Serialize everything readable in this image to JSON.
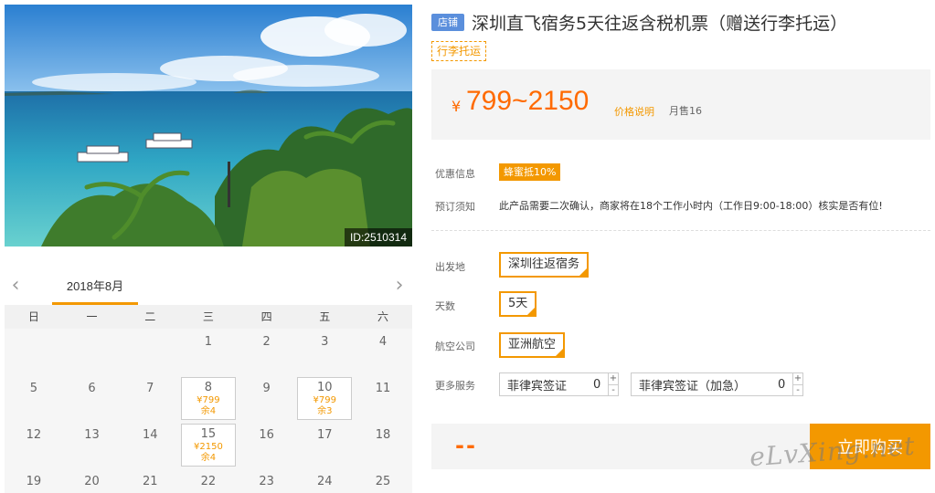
{
  "photo": {
    "id_label": "ID:2510314"
  },
  "calendar": {
    "prev_icon": "chevron-left-icon",
    "next_icon": "chevron-right-icon",
    "month_label": "2018年8月",
    "weekdays": [
      "日",
      "一",
      "二",
      "三",
      "四",
      "五",
      "六"
    ],
    "rows": [
      [
        {
          "day": ""
        },
        {
          "day": ""
        },
        {
          "day": ""
        },
        {
          "day": "1"
        },
        {
          "day": "2"
        },
        {
          "day": "3"
        },
        {
          "day": "4"
        }
      ],
      [
        {
          "day": "5"
        },
        {
          "day": "6"
        },
        {
          "day": "7"
        },
        {
          "day": "8",
          "price": "¥799",
          "left": "余4"
        },
        {
          "day": "9"
        },
        {
          "day": "10",
          "price": "¥799",
          "left": "余3"
        },
        {
          "day": "11"
        }
      ],
      [
        {
          "day": "12"
        },
        {
          "day": "13"
        },
        {
          "day": "14"
        },
        {
          "day": "15",
          "price": "¥2150",
          "left": "余4"
        },
        {
          "day": "16"
        },
        {
          "day": "17"
        },
        {
          "day": "18"
        }
      ],
      [
        {
          "day": "19"
        },
        {
          "day": "20"
        },
        {
          "day": "21"
        },
        {
          "day": "22"
        },
        {
          "day": "23"
        },
        {
          "day": "24"
        },
        {
          "day": "25"
        }
      ]
    ]
  },
  "product": {
    "shop_badge": "店铺",
    "title": "深圳直飞宿务5天往返含税机票（赠送行李托运）",
    "tag": "行李托运",
    "currency": "¥",
    "price_range": "799~2150",
    "price_note": "价格说明",
    "monthly_sales": "月售16"
  },
  "info": {
    "promo_label": "优惠信息",
    "promo_tag": "蜂蜜抵10%",
    "notice_label": "预订须知",
    "notice_text": "此产品需要二次确认，商家将在18个工作小时内（工作日9:00-18:00）核实是否有位!"
  },
  "options": {
    "departure_label": "出发地",
    "departure_value": "深圳往返宿务",
    "days_label": "天数",
    "days_value": "5天",
    "airline_label": "航空公司",
    "airline_value": "亚洲航空",
    "services_label": "更多服务",
    "services": [
      {
        "name": "菲律宾签证",
        "qty": "0",
        "plus": "+",
        "minus": "-"
      },
      {
        "name": "菲律宾签证（加急）",
        "qty": "0",
        "plus": "+",
        "minus": "-"
      }
    ]
  },
  "purchase": {
    "total": "--",
    "buy_label": "立即购买"
  },
  "watermark": "eLvXing.net",
  "colors": {
    "accent": "#f39800",
    "price": "#ff6a00",
    "badge": "#5b8fdc"
  }
}
